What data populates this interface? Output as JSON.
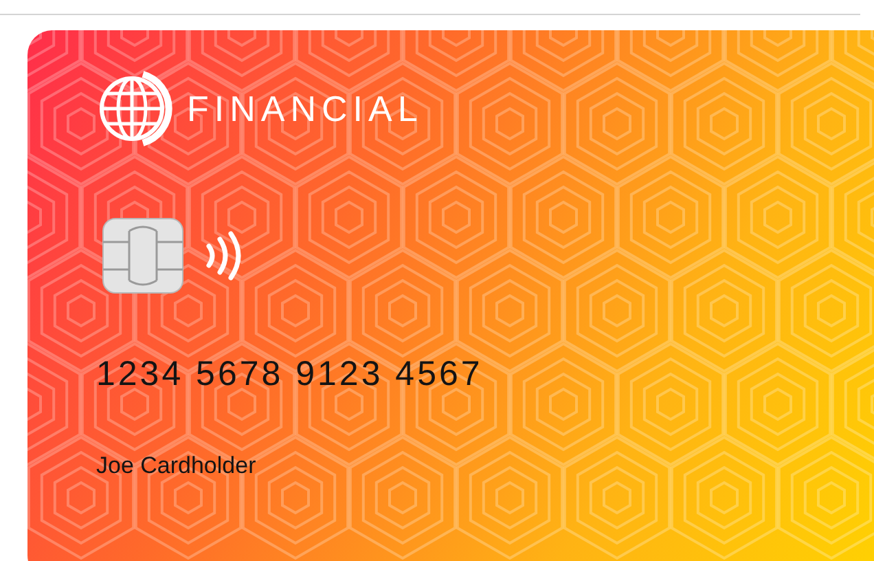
{
  "card": {
    "brand": "FINANCIAL",
    "number": "1234 5678 9123 4567",
    "holder": "Joe Cardholder"
  }
}
